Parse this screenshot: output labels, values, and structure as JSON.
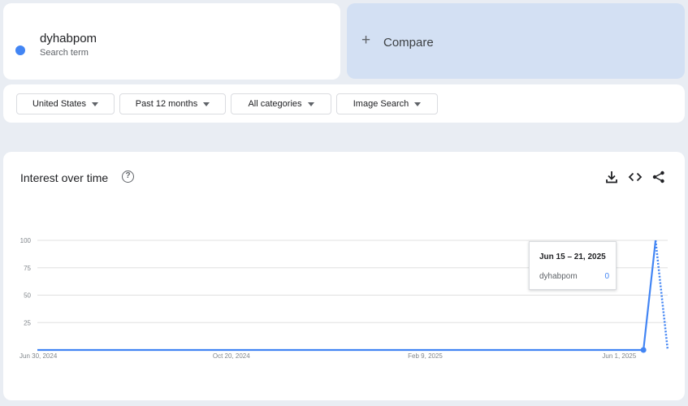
{
  "search_term": {
    "name": "dyhabpom",
    "label": "Search term",
    "color": "#4285f4"
  },
  "compare": {
    "label": "Compare",
    "icon": "plus-icon"
  },
  "filters": {
    "region": "United States",
    "time_range": "Past 12 months",
    "category": "All categories",
    "property": "Image Search"
  },
  "interest_over_time": {
    "title": "Interest over time",
    "help_icon": "help-circle-icon",
    "actions": [
      "download-icon",
      "embed-code-icon",
      "share-icon"
    ],
    "tooltip": {
      "date": "Jun 15 – 21, 2025",
      "term": "dyhabpom",
      "value": "0"
    }
  },
  "chart_data": {
    "type": "line",
    "title": "Interest over time",
    "xlabel": "",
    "ylabel": "",
    "ylim": [
      0,
      100
    ],
    "yticks": [
      25,
      50,
      75,
      100
    ],
    "xtick_labels": [
      "Jun 30, 2024",
      "Oct 20, 2024",
      "Feb 9, 2025",
      "Jun 1, 2025"
    ],
    "x_week_start": [
      "2024-06-30",
      "2025-06-15",
      "2025-06-22",
      "2025-06-29"
    ],
    "series": [
      {
        "name": "dyhabpom",
        "color": "#4285f4",
        "x": [
          "2024-06-30",
          "2025-06-15",
          "2025-06-22",
          "2025-06-29"
        ],
        "values": [
          0,
          0,
          100,
          0
        ],
        "partial_last_point": true
      }
    ],
    "grid": true,
    "highlighted_point": {
      "x": "2025-06-15",
      "value": 0
    }
  }
}
